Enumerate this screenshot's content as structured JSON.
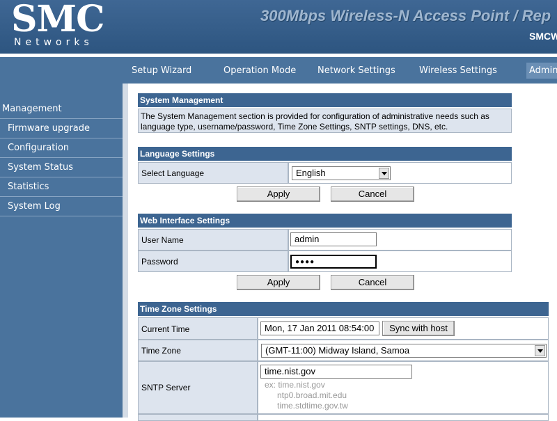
{
  "header": {
    "logo": "SMC",
    "logo_sub": "Networks",
    "product_title": "300Mbps Wireless-N Access Point / Rep",
    "product_model": "SMCW"
  },
  "nav": {
    "items": [
      "Setup Wizard",
      "Operation Mode",
      "Network Settings",
      "Wireless Settings",
      "Admin"
    ]
  },
  "sidebar": {
    "title": "Management",
    "items": [
      "Firmware upgrade",
      "Configuration",
      "System Status",
      "Statistics",
      "System Log"
    ]
  },
  "system_management": {
    "title": "System Management",
    "description": "The System Management section is provided for configuration of administrative needs such as language type, username/password, Time Zone Settings, SNTP settings, DNS, etc."
  },
  "language": {
    "title": "Language Settings",
    "select_label": "Select Language",
    "selected": "English",
    "apply": "Apply",
    "cancel": "Cancel"
  },
  "web_interface": {
    "title": "Web Interface Settings",
    "user_label": "User Name",
    "user_value": "admin",
    "password_label": "Password",
    "password_value": "●●●●",
    "apply": "Apply",
    "cancel": "Cancel"
  },
  "time_zone": {
    "title": "Time Zone Settings",
    "current_time_label": "Current Time",
    "current_time_value": "Mon, 17 Jan 2011 08:54:00",
    "sync_button": "Sync with host",
    "zone_label": "Time Zone",
    "zone_value": "(GMT-11:00) Midway Island, Samoa",
    "sntp_label": "SNTP Server",
    "sntp_value": "time.nist.gov",
    "sntp_hint_1": "ex: time.nist.gov",
    "sntp_hint_2": "ntp0.broad.mit.edu",
    "sntp_hint_3": "time.stdtime.gov.tw"
  }
}
